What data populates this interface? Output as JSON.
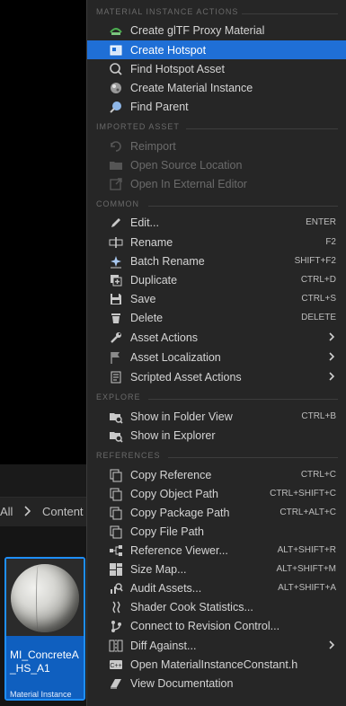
{
  "background": {
    "breadcrumb": {
      "all": "All",
      "separator": ">",
      "content": "Content"
    },
    "asset": {
      "name": "MI_ConcreteA_HS_A1",
      "type": "Material Instance"
    }
  },
  "menu": {
    "sections": [
      {
        "header": "MATERIAL INSTANCE ACTIONS"
      },
      {
        "header": "IMPORTED ASSET"
      },
      {
        "header": "COMMON"
      },
      {
        "header": "EXPLORE"
      },
      {
        "header": "REFERENCES"
      }
    ],
    "items": [
      {
        "label": "Create glTF Proxy Material",
        "icon": "gltf-icon"
      },
      {
        "label": "Create Hotspot",
        "icon": "hotspot-icon"
      },
      {
        "label": "Find Hotspot Asset",
        "icon": "search-icon"
      },
      {
        "label": "Create Material Instance",
        "icon": "material-icon"
      },
      {
        "label": "Find Parent",
        "icon": "find-parent-icon"
      },
      {
        "label": "Reimport",
        "icon": "reimport-icon"
      },
      {
        "label": "Open Source Location",
        "icon": "folder-icon"
      },
      {
        "label": "Open In External Editor",
        "icon": "external-editor-icon"
      },
      {
        "label": "Edit...",
        "shortcut": "ENTER",
        "icon": "pencil-icon"
      },
      {
        "label": "Rename",
        "shortcut": "F2",
        "icon": "rename-icon"
      },
      {
        "label": "Batch Rename",
        "shortcut": "SHIFT+F2",
        "icon": "batch-rename-icon"
      },
      {
        "label": "Duplicate",
        "shortcut": "CTRL+D",
        "icon": "duplicate-icon"
      },
      {
        "label": "Save",
        "shortcut": "CTRL+S",
        "icon": "save-icon"
      },
      {
        "label": "Delete",
        "shortcut": "DELETE",
        "icon": "trash-icon"
      },
      {
        "label": "Asset Actions",
        "icon": "wrench-icon"
      },
      {
        "label": "Asset Localization",
        "icon": "flag-icon"
      },
      {
        "label": "Scripted Asset Actions",
        "icon": "script-icon"
      },
      {
        "label": "Show in Folder View",
        "shortcut": "CTRL+B",
        "icon": "folder-search-icon"
      },
      {
        "label": "Show in Explorer",
        "icon": "explorer-icon"
      },
      {
        "label": "Copy Reference",
        "shortcut": "CTRL+C",
        "icon": "copy-icon"
      },
      {
        "label": "Copy Object Path",
        "shortcut": "CTRL+SHIFT+C",
        "icon": "copy-icon"
      },
      {
        "label": "Copy Package Path",
        "shortcut": "CTRL+ALT+C",
        "icon": "copy-icon"
      },
      {
        "label": "Copy File Path",
        "icon": "copy-icon"
      },
      {
        "label": "Reference Viewer...",
        "shortcut": "ALT+SHIFT+R",
        "icon": "reference-viewer-icon"
      },
      {
        "label": "Size Map...",
        "shortcut": "ALT+SHIFT+M",
        "icon": "size-map-icon"
      },
      {
        "label": "Audit Assets...",
        "shortcut": "ALT+SHIFT+A",
        "icon": "audit-icon"
      },
      {
        "label": "Shader Cook Statistics...",
        "icon": "shader-icon"
      },
      {
        "label": "Connect to Revision Control...",
        "icon": "revision-control-icon"
      },
      {
        "label": "Diff Against...",
        "icon": "diff-icon"
      },
      {
        "label": "Open MaterialInstanceConstant.h",
        "icon": "cpp-icon"
      },
      {
        "label": "View Documentation",
        "icon": "book-icon"
      }
    ],
    "submenu_arrow": ">",
    "highlight_color": "#1f6fd6"
  }
}
